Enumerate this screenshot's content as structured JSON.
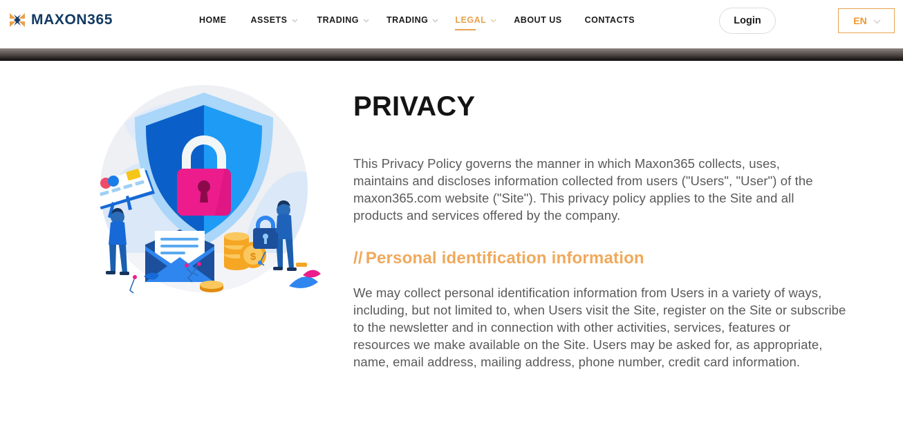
{
  "header": {
    "brand": {
      "name": "MAXON365",
      "logo_icon": "x-mark-logo-icon",
      "text_color": "#123a63",
      "accent_color": "#e8a24e"
    },
    "nav": [
      {
        "label": "HOME",
        "has_caret": false,
        "active": false
      },
      {
        "label": "ASSETS",
        "has_caret": true,
        "active": false
      },
      {
        "label": "TRADING",
        "has_caret": true,
        "active": false
      },
      {
        "label": "TRADING",
        "has_caret": true,
        "active": false
      },
      {
        "label": "LEGAL",
        "has_caret": true,
        "active": true
      },
      {
        "label": "ABOUT US",
        "has_caret": false,
        "active": false
      },
      {
        "label": "CONTACTS",
        "has_caret": false,
        "active": false
      }
    ],
    "login_label": "Login",
    "language": {
      "code": "EN",
      "caret_icon": "chevron-down-icon"
    }
  },
  "main": {
    "title": "PRIVACY",
    "intro_paragraph": "This Privacy Policy governs the manner in which Maxon365 collects, uses, maintains and discloses information collected from users (\"Users\", \"User\") of the maxon365.com website (\"Site\"). This privacy policy applies to the Site and all products and services offered by the company.",
    "section": {
      "slashes": "//",
      "heading": "Personal identification information",
      "paragraph": "We may collect personal identification information from Users in a variety of ways, including, but not limited to, when Users visit the Site, register on the Site or subscribe to the newsletter and in connection with other activities, services, features or resources we make available on the Site. Users may be asked for, as appropriate, name, email address, mailing address, phone number, credit card information."
    },
    "illustration": {
      "name": "privacy-security-illustration",
      "elements": [
        "shield-icon",
        "padlock-icon",
        "globe-icon",
        "credit-card-icon",
        "envelope-icon",
        "coins-icon",
        "person-holding-card",
        "person-holding-padlock"
      ],
      "colors": {
        "backdrop": "#eef0f4",
        "shield_left": "#0b5fc8",
        "shield_right": "#1e9bf5",
        "shield_border": "#a9d6f9",
        "lock_body": "#ec1c8c",
        "accent_yellow": "#f5a623",
        "pale_blue": "#cfe4fa"
      }
    }
  },
  "theme": {
    "accent": "#e8a24e",
    "orange": "#f0992e",
    "brand_navy": "#123a63",
    "text_body": "#595959",
    "text_heading": "#141414"
  }
}
